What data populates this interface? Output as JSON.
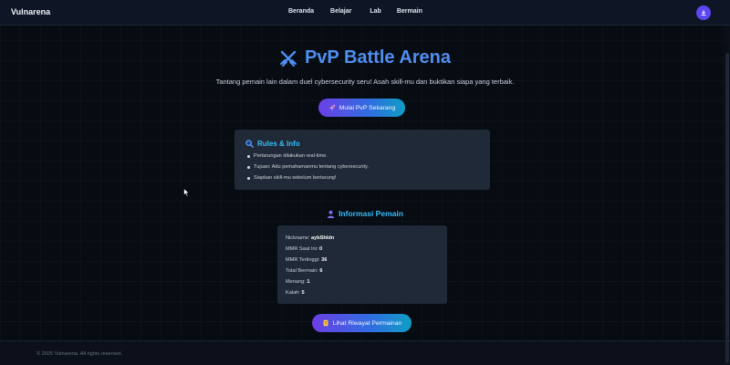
{
  "navbar": {
    "brand": "Vulnarena",
    "links": [
      {
        "label": "Beranda"
      },
      {
        "label": "Belajar"
      },
      {
        "label": "Lab"
      },
      {
        "label": "Bermain"
      }
    ],
    "avatar_icon": "user-download-icon"
  },
  "hero": {
    "icon": "crossed-swords-icon",
    "title": "PvP Battle Arena",
    "subtitle": "Tantang pemain lain dalam duel cybersecurity seru! Asah skill-mu dan buktikan siapa yang terbaik.",
    "start_button": {
      "icon": "rocket-icon",
      "label": "Mulai PvP Sekarang"
    }
  },
  "rules": {
    "icon": "magnifier-icon",
    "title": "Rules & Info",
    "items": [
      "Pertarungan dilakukan real-time.",
      "Tujuan: Adu pemahamanmu tentang cybersecurity.",
      "Siapkan skill-mu sebelum bertarung!"
    ]
  },
  "player_info": {
    "icon": "user-icon",
    "title": "Informasi Pemain",
    "rows": [
      {
        "label": "Nickname:",
        "value": "aybShldn"
      },
      {
        "label": "MMR Saat Ini:",
        "value": "0"
      },
      {
        "label": "MMR Tertinggi:",
        "value": "36"
      },
      {
        "label": "Total Bermain:",
        "value": "6"
      },
      {
        "label": "Menang:",
        "value": "1"
      },
      {
        "label": "Kalah:",
        "value": "5"
      }
    ]
  },
  "history_button": {
    "icon": "scroll-icon",
    "label": "Lihat Riwayat Permainan"
  },
  "footer": {
    "text": "© 2025 Vulnarena. All rights reserved."
  },
  "colors": {
    "accent": "#4f8ff0",
    "cyan": "#38bdf8",
    "card_bg": "#1f2937",
    "page_bg": "#070b12",
    "button_gradient_start": "#6b3fe6",
    "button_gradient_end": "#0f9ec4"
  }
}
